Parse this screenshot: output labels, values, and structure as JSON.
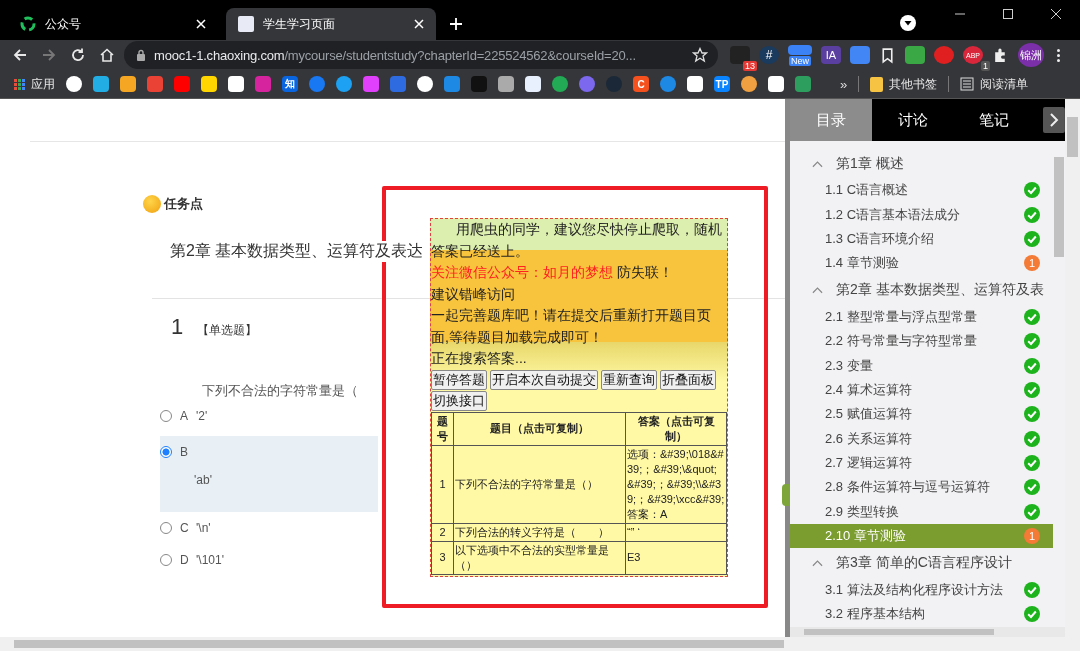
{
  "browser": {
    "tabs": [
      {
        "title": "公众号",
        "kind": "wechat",
        "selected": false
      },
      {
        "title": "学生学习页面",
        "kind": "page",
        "selected": true
      }
    ],
    "url_host": "mooc1-1.chaoxing.com",
    "url_path": "/mycourse/studentstudy?chapterId=225524562&courseId=20...",
    "extensions": [
      {
        "kind": "dark",
        "badge": "13"
      },
      {
        "kind": "hash",
        "label": "#"
      },
      {
        "kind": "new",
        "badge": "New"
      },
      {
        "kind": "ia",
        "label": "IA"
      },
      {
        "kind": "translate"
      },
      {
        "kind": "bookmark"
      },
      {
        "kind": "idm"
      },
      {
        "kind": "stop"
      },
      {
        "kind": "abp",
        "label": "ABP",
        "badge": "1"
      },
      {
        "kind": "puzzle"
      },
      {
        "kind": "profile",
        "label": "锦洲"
      },
      {
        "kind": "more"
      }
    ],
    "bookmarks": [
      {
        "kind": "apps",
        "label": "应用"
      },
      {
        "kind": "globe"
      },
      {
        "kind": "tv"
      },
      {
        "kind": "bars"
      },
      {
        "kind": "mail"
      },
      {
        "kind": "play"
      },
      {
        "kind": "yellow"
      },
      {
        "kind": "cat"
      },
      {
        "kind": "insta"
      },
      {
        "kind": "zhi",
        "label": "知"
      },
      {
        "kind": "fb"
      },
      {
        "kind": "bird"
      },
      {
        "kind": "dots"
      },
      {
        "kind": "paw"
      },
      {
        "kind": "g"
      },
      {
        "kind": "p"
      },
      {
        "kind": "block"
      },
      {
        "kind": "chip"
      },
      {
        "kind": "cloud"
      },
      {
        "kind": "ring"
      },
      {
        "kind": "link"
      },
      {
        "kind": "steam"
      },
      {
        "kind": "c",
        "label": "C"
      },
      {
        "kind": "b"
      },
      {
        "kind": "flask"
      },
      {
        "kind": "tp",
        "label": "TP"
      },
      {
        "kind": "ball"
      },
      {
        "kind": "wave"
      },
      {
        "kind": "map"
      }
    ],
    "more_bookmarks": "»",
    "folders": [
      {
        "kind": "folder",
        "label": "其他书签"
      },
      {
        "kind": "list",
        "label": "阅读清单"
      }
    ]
  },
  "main": {
    "task_label": "任务点",
    "chapter_title": "第2章 基本数据类型、运算符及表达",
    "question_number": "1",
    "question_type": "【单选题】",
    "question": "下列不合法的字符常量是（",
    "options": [
      {
        "letter": "A",
        "text": "'2'",
        "selected": false
      },
      {
        "letter": "B",
        "text": "'ab'",
        "selected": true
      },
      {
        "letter": "C",
        "text": "'\\n'",
        "selected": false
      },
      {
        "letter": "D",
        "text": "'\\101'",
        "selected": false
      }
    ]
  },
  "helper": {
    "notice": "用爬虫的同学，建议您尽快停止爬取，随机答案已经送上。",
    "follow": "关注微信公众号：如月的梦想",
    "follow_tail": " 防失联！",
    "hint": "建议错峰访问",
    "invite": "一起完善题库吧！请在提交后重新打开题目页面,等待题目加载完成即可！",
    "status": "正在搜索答案...",
    "buttons": [
      "暂停答题",
      "开启本次自动提交",
      "重新查询",
      "折叠面板",
      "切换接口"
    ],
    "columns": [
      "题号",
      "题目（点击可复制）",
      "答案（点击可复制）"
    ],
    "rows": [
      {
        "no": "1",
        "question": "下列不合法的字符常量是（）",
        "answer": "选项：&#39;\\018&#39;；&#39;\\&quot; &#39;；&#39;\\\\&#39;；&#39;\\xcc&#39; 答案：A"
      },
      {
        "no": "2",
        "question": "下列合法的转义字符是（　　）",
        "answer": "“” ‘"
      },
      {
        "no": "3",
        "question": "以下选项中不合法的实型常量是（）",
        "answer": "E3"
      }
    ]
  },
  "sidebar": {
    "tabs": [
      {
        "label": "目录",
        "selected": true
      },
      {
        "label": "讨论",
        "selected": false
      },
      {
        "label": "笔记",
        "selected": false
      }
    ],
    "chapters": [
      {
        "title": "第1章 概述",
        "expanded": true,
        "children": [
          {
            "label": "1.1 C语言概述",
            "done": true,
            "selected": false
          },
          {
            "label": "1.2 C语言基本语法成分",
            "done": true,
            "selected": false
          },
          {
            "label": "1.3 C语言环境介绍",
            "done": true,
            "selected": false
          },
          {
            "label": "1.4 章节测验",
            "done": false,
            "badge": "1",
            "selected": false
          }
        ]
      },
      {
        "title": "第2章 基本数据类型、运算符及表",
        "expanded": true,
        "children": [
          {
            "label": "2.1 整型常量与浮点型常量",
            "done": true,
            "selected": false
          },
          {
            "label": "2.2 符号常量与字符型常量",
            "done": true,
            "selected": false
          },
          {
            "label": "2.3 变量",
            "done": true,
            "selected": false
          },
          {
            "label": "2.4 算术运算符",
            "done": true,
            "selected": false
          },
          {
            "label": "2.5 赋值运算符",
            "done": true,
            "selected": false
          },
          {
            "label": "2.6 关系运算符",
            "done": true,
            "selected": false
          },
          {
            "label": "2.7 逻辑运算符",
            "done": true,
            "selected": false
          },
          {
            "label": "2.8 条件运算符与逗号运算符",
            "done": true,
            "selected": false
          },
          {
            "label": "2.9 类型转换",
            "done": true,
            "selected": false
          },
          {
            "label": "2.10 章节测验",
            "done": false,
            "badge": "1",
            "selected": true
          }
        ]
      },
      {
        "title": "第3章 简单的C语言程序设计",
        "expanded": true,
        "children": [
          {
            "label": "3.1 算法及结构化程序设计方法",
            "done": true,
            "selected": false
          },
          {
            "label": "3.2 程序基本结构",
            "done": true,
            "selected": false
          }
        ]
      }
    ]
  }
}
